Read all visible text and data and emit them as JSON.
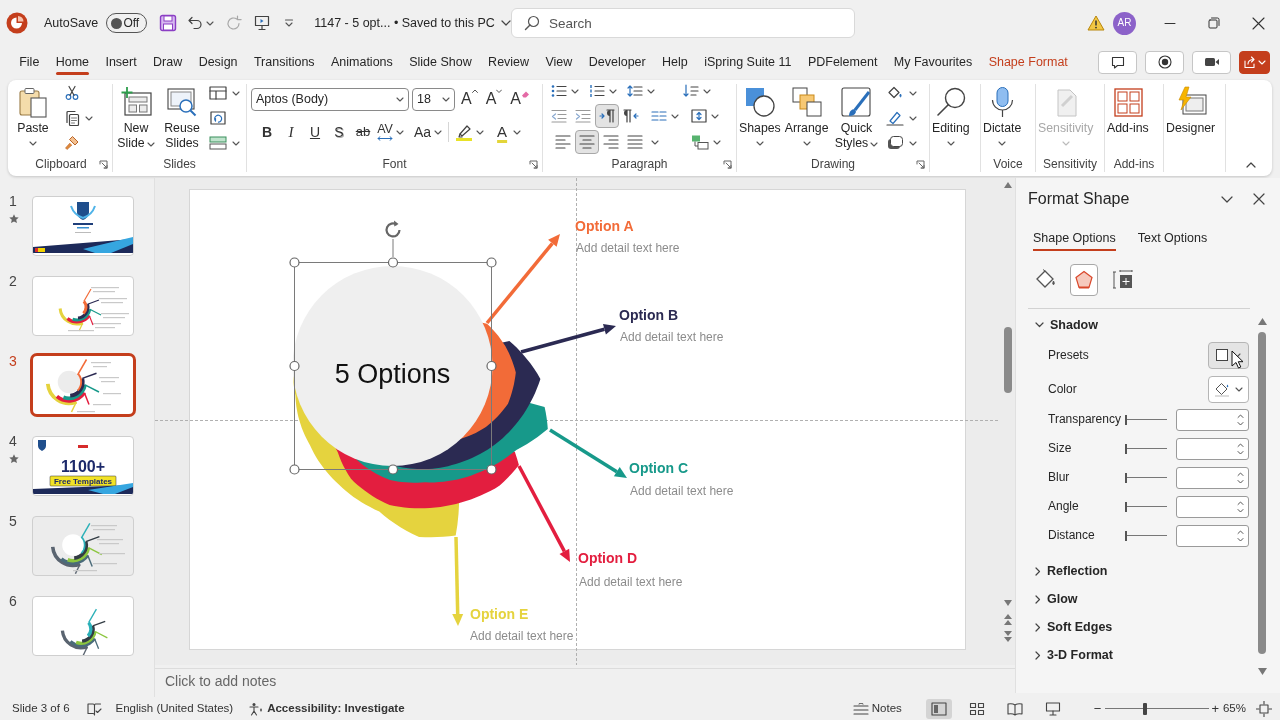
{
  "title_bar": {
    "autosave": {
      "label": "AutoSave",
      "on": false,
      "state_text": "Off"
    },
    "document": "1147 - 5 opt... • Saved to this PC",
    "search": {
      "placeholder": "Search"
    },
    "account": {
      "initials": "AR"
    }
  },
  "tabs": [
    {
      "label": "File",
      "selected": false,
      "contextual": false
    },
    {
      "label": "Home",
      "selected": true,
      "contextual": false
    },
    {
      "label": "Insert",
      "selected": false,
      "contextual": false
    },
    {
      "label": "Draw",
      "selected": false,
      "contextual": false
    },
    {
      "label": "Design",
      "selected": false,
      "contextual": false
    },
    {
      "label": "Transitions",
      "selected": false,
      "contextual": false
    },
    {
      "label": "Animations",
      "selected": false,
      "contextual": false
    },
    {
      "label": "Slide Show",
      "selected": false,
      "contextual": false
    },
    {
      "label": "Review",
      "selected": false,
      "contextual": false
    },
    {
      "label": "View",
      "selected": false,
      "contextual": false
    },
    {
      "label": "Developer",
      "selected": false,
      "contextual": false
    },
    {
      "label": "Help",
      "selected": false,
      "contextual": false
    },
    {
      "label": "iSpring Suite 11",
      "selected": false,
      "contextual": false
    },
    {
      "label": "PDFelement",
      "selected": false,
      "contextual": false
    },
    {
      "label": "My Favourites",
      "selected": false,
      "contextual": false
    },
    {
      "label": "Shape Format",
      "selected": false,
      "contextual": true
    }
  ],
  "ribbon": {
    "clipboard": {
      "label": "Clipboard",
      "paste": "Paste"
    },
    "slides": {
      "label": "Slides",
      "new_slide": "New Slide",
      "reuse_slides": "Reuse Slides"
    },
    "font": {
      "label": "Font",
      "name": "Aptos (Body)",
      "size": "18",
      "grow": "A",
      "shrink": "A",
      "clear": "A",
      "bold": "B",
      "italic": "I",
      "underline": "U",
      "shadow": "S",
      "strikethrough": "ab",
      "spacing": "AV",
      "change_case": "Aa",
      "font_color": "A"
    },
    "paragraph": {
      "label": "Paragraph",
      "direction": [
        {
          "selected": true
        },
        {
          "selected": false
        }
      ],
      "alignment": [
        {
          "selected": false
        },
        {
          "selected": true
        },
        {
          "selected": false
        },
        {
          "selected": false
        }
      ]
    },
    "drawing": {
      "label": "Drawing",
      "shapes": "Shapes",
      "arrange": "Arrange",
      "quick_styles": "Quick Styles"
    },
    "editing": {
      "button": "Editing"
    },
    "voice": {
      "label": "Voice",
      "dictate": "Dictate"
    },
    "sensitivity": {
      "label": "Sensitivity",
      "button": "Sensitivity",
      "disabled": true
    },
    "add_ins": {
      "label": "Add-ins",
      "button": "Add-ins"
    },
    "designer": {
      "button": "Designer"
    }
  },
  "slides_panel": [
    {
      "number": "1",
      "animated": true,
      "selected": false
    },
    {
      "number": "2",
      "animated": false,
      "selected": false
    },
    {
      "number": "3",
      "animated": false,
      "selected": true
    },
    {
      "number": "4",
      "animated": true,
      "selected": false,
      "heading": "1100+",
      "badge": "Free Templates"
    },
    {
      "number": "5",
      "animated": false,
      "selected": false
    },
    {
      "number": "6",
      "animated": false,
      "selected": false
    }
  ],
  "slide": {
    "shape": {
      "text": "5 Options",
      "selected": true
    },
    "options": [
      {
        "title": "Option A",
        "detail": "Add detail text here",
        "color": "#f26b38"
      },
      {
        "title": "Option B",
        "detail": "Add detail text here",
        "color": "#2b2a52"
      },
      {
        "title": "Option C",
        "detail": "Add detail text here",
        "color": "#17998a"
      },
      {
        "title": "Option D",
        "detail": "Add detail text here",
        "color": "#e31e3f"
      },
      {
        "title": "Option E",
        "detail": "Add detail text here",
        "color": "#e5d33e"
      }
    ]
  },
  "notes": {
    "placeholder": "Click to add notes"
  },
  "format_pane": {
    "title": "Format Shape",
    "tabs": [
      {
        "label": "Shape Options",
        "selected": true
      },
      {
        "label": "Text Options",
        "selected": false
      }
    ],
    "icon_tabs": [
      {
        "selected": false
      },
      {
        "selected": true
      },
      {
        "selected": false
      }
    ],
    "sections": [
      {
        "label": "Shadow",
        "expanded": true,
        "rows": [
          {
            "kind": "preset",
            "label": "Presets"
          },
          {
            "kind": "color",
            "label": "Color"
          },
          {
            "kind": "slider",
            "label": "Transparency",
            "level": 0
          },
          {
            "kind": "slider",
            "label": "Size",
            "level": 0
          },
          {
            "kind": "slider",
            "label": "Blur",
            "level": 0
          },
          {
            "kind": "slider",
            "label": "Angle",
            "level": 0
          },
          {
            "kind": "slider",
            "label": "Distance",
            "level": 0
          }
        ]
      },
      {
        "label": "Reflection",
        "expanded": false
      },
      {
        "label": "Glow",
        "expanded": false
      },
      {
        "label": "Soft Edges",
        "expanded": false
      },
      {
        "label": "3-D Format",
        "expanded": false
      }
    ]
  },
  "status_bar": {
    "slide_info": "Slide 3 of 6",
    "language": "English (United States)",
    "accessibility": "Accessibility: Investigate",
    "notes": "Notes",
    "views": [
      {
        "selected": true
      },
      {
        "selected": false
      },
      {
        "selected": false
      },
      {
        "selected": false
      }
    ],
    "zoom": {
      "minus": "−",
      "plus": "+",
      "level": 0.38,
      "reading": "65%"
    }
  }
}
